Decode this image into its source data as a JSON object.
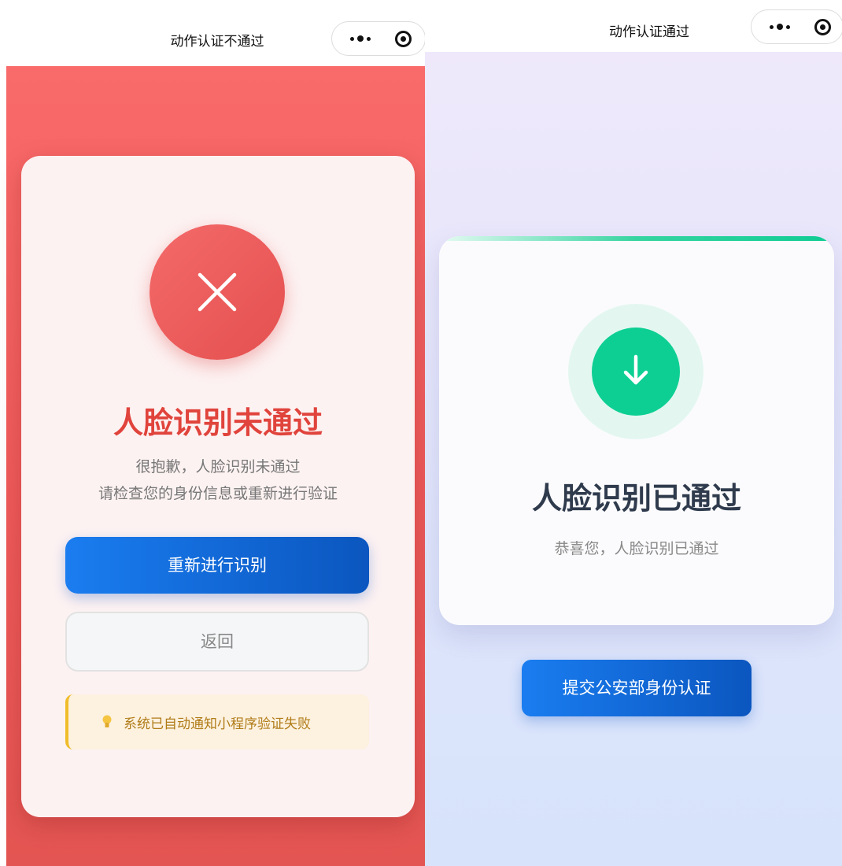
{
  "left_screen": {
    "nav": {
      "title": "动作认证不通过"
    },
    "status_icon": "close-icon",
    "title": "人脸识别未通过",
    "message_line1": "很抱歉，人脸识别未通过",
    "message_line2": "请检查您的身份信息或重新进行验证",
    "retry_label": "重新进行识别",
    "back_label": "返回",
    "notice": {
      "icon": "lightbulb-icon",
      "text": "系统已自动通知小程序验证失败"
    },
    "colors": {
      "background": "#f96a6a",
      "title": "#e0443c",
      "primary_button": "#1a7df0",
      "notice_bg": "#fdf1df",
      "notice_border": "#f0bd2a"
    }
  },
  "right_screen": {
    "nav": {
      "title": "动作认证通过"
    },
    "status_icon": "arrow-down-icon",
    "title": "人脸识别已通过",
    "message": "恭喜您，人脸识别已通过",
    "submit_label": "提交公安部身份认证",
    "colors": {
      "accent": "#0fcc94",
      "title": "#2f3b4d",
      "primary_button": "#1a7df0"
    }
  },
  "capsule_icons": [
    "more-icon",
    "target-icon"
  ]
}
